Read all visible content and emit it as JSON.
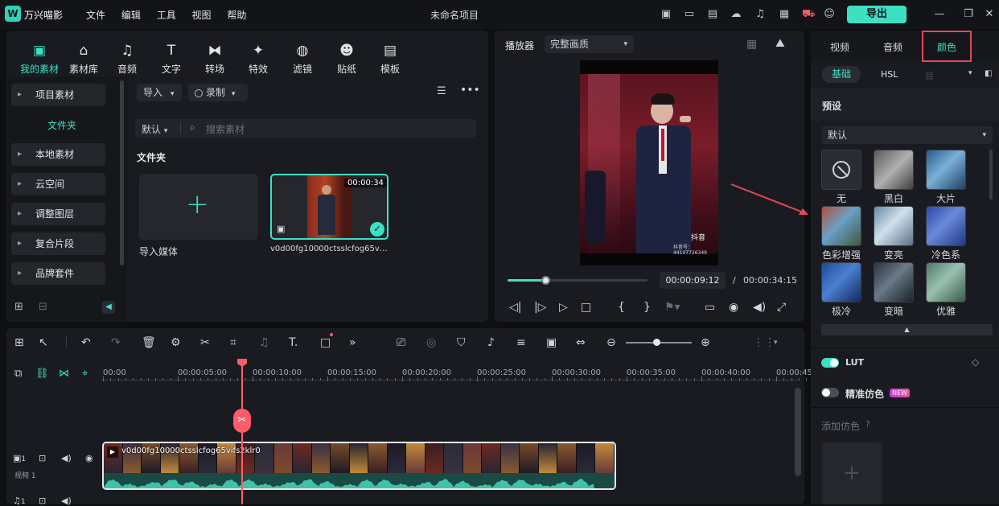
{
  "app": {
    "name": "万兴喵影",
    "project_title": "未命名项目",
    "export_label": "导出"
  },
  "menu": [
    "文件",
    "编辑",
    "工具",
    "视图",
    "帮助"
  ],
  "toolbar": [
    "我的素材",
    "素材库",
    "音频",
    "文字",
    "转场",
    "特效",
    "滤镜",
    "贴纸",
    "模板"
  ],
  "sidebar": {
    "items": [
      "项目素材",
      "文件夹",
      "本地素材",
      "云空间",
      "调整图层",
      "复合片段",
      "品牌套件"
    ]
  },
  "media": {
    "import_label": "导入",
    "record_label": "录制",
    "sort_label": "默认",
    "search_placeholder": "搜索素材",
    "folder_heading": "文件夹",
    "import_media_label": "导入媒体",
    "clip_duration": "00:00:34",
    "clip_name": "v0d00fg10000ctsslcfog65v…"
  },
  "player": {
    "title": "播放器",
    "quality": "完整画质",
    "current_time": "00:00:09:12",
    "total_time": "00:00:34:15",
    "progress": 0.27,
    "watermark_brand": "抖音",
    "watermark_id": "抖音号：44107726349"
  },
  "timeline": {
    "ticks": [
      "00:00",
      "00:00:05:00",
      "00:00:10:00",
      "00:00:15:00",
      "00:00:20:00",
      "00:00:25:00",
      "00:00:30:00",
      "00:00:35:00",
      "00:00:40:00",
      "00:00:45:00"
    ],
    "clip_name": "v0d00fg10000ctsslcfog65vifs2klr0",
    "track_video_label": "视频 1",
    "track_index_video": "1",
    "track_index_audio": "1"
  },
  "right_panel": {
    "tabs": [
      "视频",
      "音频",
      "颜色"
    ],
    "active_tab": "颜色",
    "subtabs": [
      "基础",
      "HSL",
      "目"
    ],
    "preset_heading": "预设",
    "preset_dropdown": "默认",
    "presets": [
      "无",
      "黑白",
      "大片",
      "色彩增强",
      "变亮",
      "冷色系",
      "极冷",
      "变暗",
      "优雅"
    ],
    "lut_label": "LUT",
    "fake_color_label": "精准仿色",
    "new_badge": "NEW",
    "add_fake_color": "添加仿色"
  },
  "colors": {
    "accent": "#3ee0c3",
    "highlight_red": "#e04a5a",
    "playhead": "#ff5c6a"
  }
}
